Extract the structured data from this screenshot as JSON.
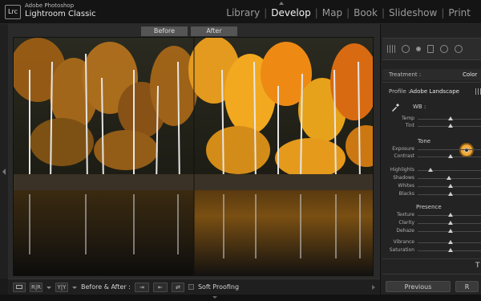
{
  "app": {
    "logo_text": "Lrc",
    "brand_small": "Adobe Photoshop",
    "brand_big": "Lightroom Classic"
  },
  "modules": [
    {
      "label": "Library",
      "active": false
    },
    {
      "label": "Develop",
      "active": true
    },
    {
      "label": "Map",
      "active": false
    },
    {
      "label": "Book",
      "active": false
    },
    {
      "label": "Slideshow",
      "active": false
    },
    {
      "label": "Print",
      "active": false
    }
  ],
  "compare": {
    "before_label": "Before",
    "after_label": "After"
  },
  "toolbar": {
    "view_icon": "loupe-icon",
    "ba_mode_1": "R|R",
    "ba_mode_2": "Y|Y",
    "before_after_label": "Before & After :",
    "soft_proofing_label": "Soft Proofing",
    "soft_proofing_checked": false
  },
  "basic": {
    "treatment_label": "Treatment :",
    "treatment_value": "Color",
    "profile_label": "Profile :",
    "profile_value": "Adobe Landscape",
    "wb_label": "WB :",
    "tone_label": "Tone",
    "presence_label": "Presence",
    "sliders": {
      "temp": {
        "label": "Temp",
        "value": 0.5
      },
      "tint": {
        "label": "Tint",
        "value": 0.5
      },
      "exposure": {
        "label": "Exposure",
        "value": 0.5
      },
      "contrast": {
        "label": "Contrast",
        "value": 0.5
      },
      "highlights": {
        "label": "Highlights",
        "value": 0.2
      },
      "shadows": {
        "label": "Shadows",
        "value": 0.48
      },
      "whites": {
        "label": "Whites",
        "value": 0.5
      },
      "blacks": {
        "label": "Blacks",
        "value": 0.5
      },
      "texture": {
        "label": "Texture",
        "value": 0.5
      },
      "clarity": {
        "label": "Clarity",
        "value": 0.5
      },
      "dehaze": {
        "label": "Dehaze",
        "value": 0.5
      },
      "vibrance": {
        "label": "Vibrance",
        "value": 0.5
      },
      "saturation": {
        "label": "Saturation",
        "value": 0.5
      }
    }
  },
  "footer": {
    "previous_label": "Previous",
    "reset_label": "R",
    "side_letter": "T"
  }
}
